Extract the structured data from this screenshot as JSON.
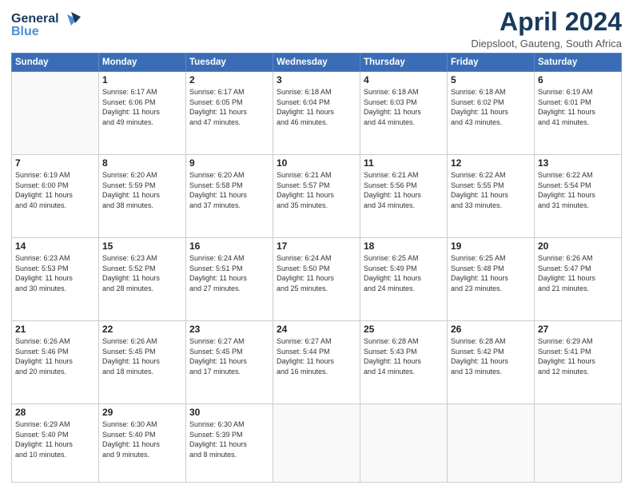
{
  "logo": {
    "line1": "General",
    "line2": "Blue"
  },
  "title": "April 2024",
  "location": "Diepsloot, Gauteng, South Africa",
  "weekdays": [
    "Sunday",
    "Monday",
    "Tuesday",
    "Wednesday",
    "Thursday",
    "Friday",
    "Saturday"
  ],
  "weeks": [
    [
      {
        "day": "",
        "info": ""
      },
      {
        "day": "1",
        "info": "Sunrise: 6:17 AM\nSunset: 6:06 PM\nDaylight: 11 hours\nand 49 minutes."
      },
      {
        "day": "2",
        "info": "Sunrise: 6:17 AM\nSunset: 6:05 PM\nDaylight: 11 hours\nand 47 minutes."
      },
      {
        "day": "3",
        "info": "Sunrise: 6:18 AM\nSunset: 6:04 PM\nDaylight: 11 hours\nand 46 minutes."
      },
      {
        "day": "4",
        "info": "Sunrise: 6:18 AM\nSunset: 6:03 PM\nDaylight: 11 hours\nand 44 minutes."
      },
      {
        "day": "5",
        "info": "Sunrise: 6:18 AM\nSunset: 6:02 PM\nDaylight: 11 hours\nand 43 minutes."
      },
      {
        "day": "6",
        "info": "Sunrise: 6:19 AM\nSunset: 6:01 PM\nDaylight: 11 hours\nand 41 minutes."
      }
    ],
    [
      {
        "day": "7",
        "info": "Sunrise: 6:19 AM\nSunset: 6:00 PM\nDaylight: 11 hours\nand 40 minutes."
      },
      {
        "day": "8",
        "info": "Sunrise: 6:20 AM\nSunset: 5:59 PM\nDaylight: 11 hours\nand 38 minutes."
      },
      {
        "day": "9",
        "info": "Sunrise: 6:20 AM\nSunset: 5:58 PM\nDaylight: 11 hours\nand 37 minutes."
      },
      {
        "day": "10",
        "info": "Sunrise: 6:21 AM\nSunset: 5:57 PM\nDaylight: 11 hours\nand 35 minutes."
      },
      {
        "day": "11",
        "info": "Sunrise: 6:21 AM\nSunset: 5:56 PM\nDaylight: 11 hours\nand 34 minutes."
      },
      {
        "day": "12",
        "info": "Sunrise: 6:22 AM\nSunset: 5:55 PM\nDaylight: 11 hours\nand 33 minutes."
      },
      {
        "day": "13",
        "info": "Sunrise: 6:22 AM\nSunset: 5:54 PM\nDaylight: 11 hours\nand 31 minutes."
      }
    ],
    [
      {
        "day": "14",
        "info": "Sunrise: 6:23 AM\nSunset: 5:53 PM\nDaylight: 11 hours\nand 30 minutes."
      },
      {
        "day": "15",
        "info": "Sunrise: 6:23 AM\nSunset: 5:52 PM\nDaylight: 11 hours\nand 28 minutes."
      },
      {
        "day": "16",
        "info": "Sunrise: 6:24 AM\nSunset: 5:51 PM\nDaylight: 11 hours\nand 27 minutes."
      },
      {
        "day": "17",
        "info": "Sunrise: 6:24 AM\nSunset: 5:50 PM\nDaylight: 11 hours\nand 25 minutes."
      },
      {
        "day": "18",
        "info": "Sunrise: 6:25 AM\nSunset: 5:49 PM\nDaylight: 11 hours\nand 24 minutes."
      },
      {
        "day": "19",
        "info": "Sunrise: 6:25 AM\nSunset: 5:48 PM\nDaylight: 11 hours\nand 23 minutes."
      },
      {
        "day": "20",
        "info": "Sunrise: 6:26 AM\nSunset: 5:47 PM\nDaylight: 11 hours\nand 21 minutes."
      }
    ],
    [
      {
        "day": "21",
        "info": "Sunrise: 6:26 AM\nSunset: 5:46 PM\nDaylight: 11 hours\nand 20 minutes."
      },
      {
        "day": "22",
        "info": "Sunrise: 6:26 AM\nSunset: 5:45 PM\nDaylight: 11 hours\nand 18 minutes."
      },
      {
        "day": "23",
        "info": "Sunrise: 6:27 AM\nSunset: 5:45 PM\nDaylight: 11 hours\nand 17 minutes."
      },
      {
        "day": "24",
        "info": "Sunrise: 6:27 AM\nSunset: 5:44 PM\nDaylight: 11 hours\nand 16 minutes."
      },
      {
        "day": "25",
        "info": "Sunrise: 6:28 AM\nSunset: 5:43 PM\nDaylight: 11 hours\nand 14 minutes."
      },
      {
        "day": "26",
        "info": "Sunrise: 6:28 AM\nSunset: 5:42 PM\nDaylight: 11 hours\nand 13 minutes."
      },
      {
        "day": "27",
        "info": "Sunrise: 6:29 AM\nSunset: 5:41 PM\nDaylight: 11 hours\nand 12 minutes."
      }
    ],
    [
      {
        "day": "28",
        "info": "Sunrise: 6:29 AM\nSunset: 5:40 PM\nDaylight: 11 hours\nand 10 minutes."
      },
      {
        "day": "29",
        "info": "Sunrise: 6:30 AM\nSunset: 5:40 PM\nDaylight: 11 hours\nand 9 minutes."
      },
      {
        "day": "30",
        "info": "Sunrise: 6:30 AM\nSunset: 5:39 PM\nDaylight: 11 hours\nand 8 minutes."
      },
      {
        "day": "",
        "info": ""
      },
      {
        "day": "",
        "info": ""
      },
      {
        "day": "",
        "info": ""
      },
      {
        "day": "",
        "info": ""
      }
    ]
  ]
}
